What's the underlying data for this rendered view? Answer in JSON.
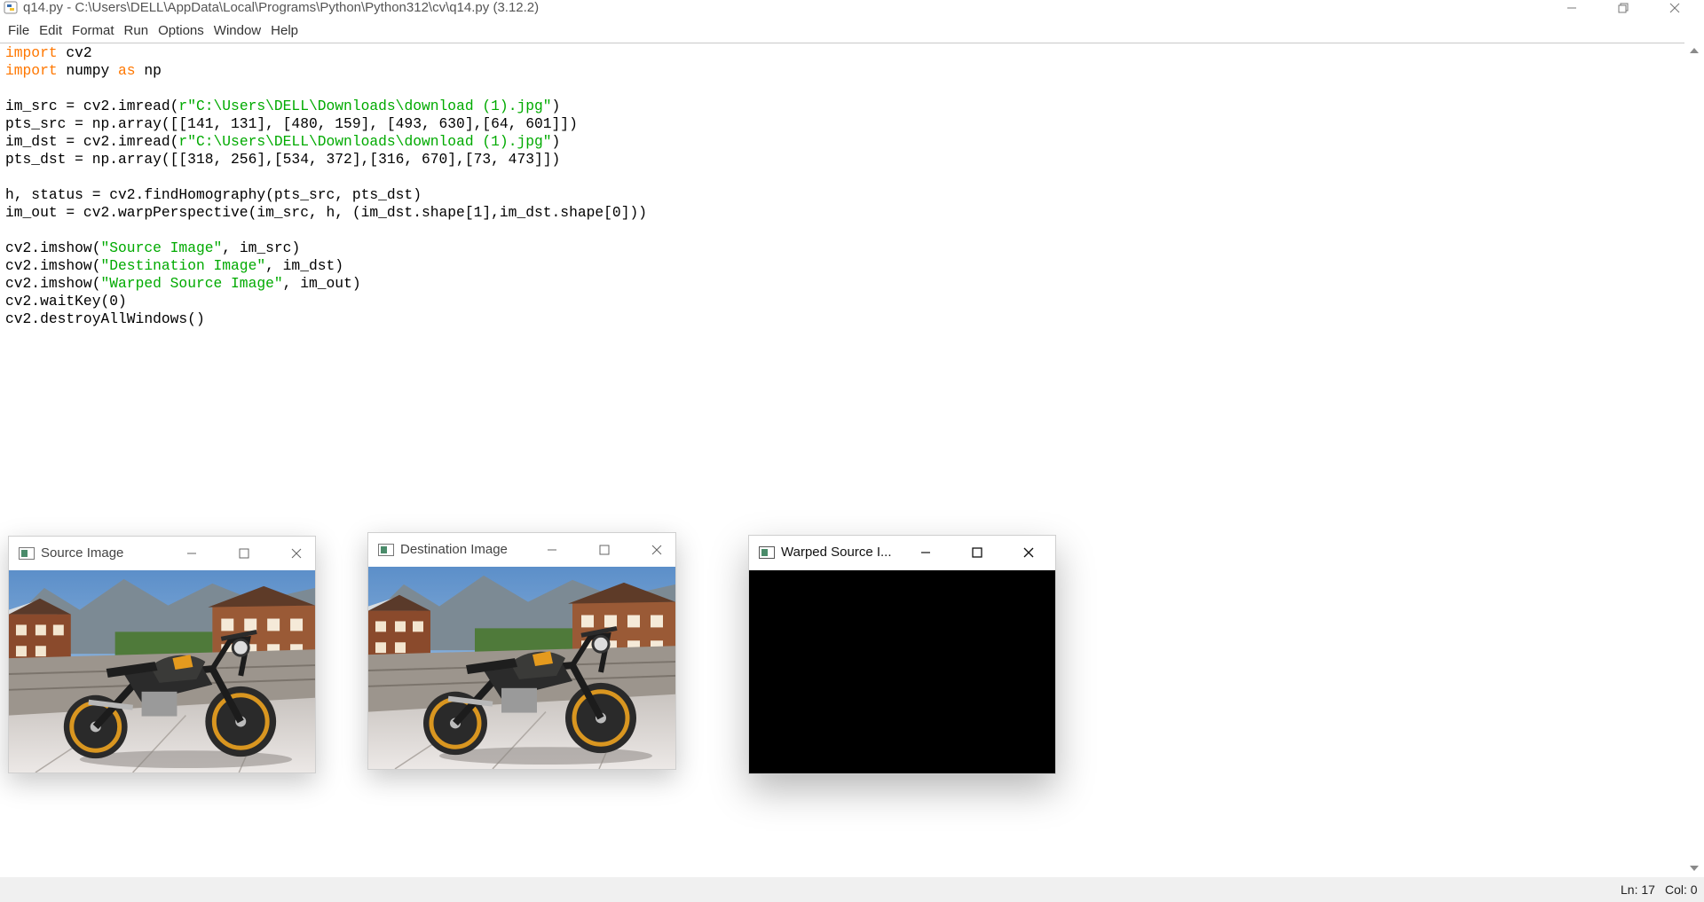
{
  "window": {
    "title": "q14.py - C:\\Users\\DELL\\AppData\\Local\\Programs\\Python\\Python312\\cv\\q14.py (3.12.2)",
    "controls": [
      "minimize-icon",
      "restore-icon",
      "close-icon"
    ]
  },
  "menu": {
    "items": [
      {
        "label": "File"
      },
      {
        "label": "Edit"
      },
      {
        "label": "Format"
      },
      {
        "label": "Run"
      },
      {
        "label": "Options"
      },
      {
        "label": "Window"
      },
      {
        "label": "Help"
      }
    ]
  },
  "editor": {
    "lines": [
      [
        {
          "t": "import",
          "c": "kw"
        },
        {
          "t": " cv2"
        }
      ],
      [
        {
          "t": "import",
          "c": "kw"
        },
        {
          "t": " numpy "
        },
        {
          "t": "as",
          "c": "kw"
        },
        {
          "t": " np"
        }
      ],
      [],
      [
        {
          "t": "im_src = cv2.imread("
        },
        {
          "t": "r\"C:\\Users\\DELL\\Downloads\\download (1).jpg\"",
          "c": "str"
        },
        {
          "t": ")"
        }
      ],
      [
        {
          "t": "pts_src = np.array([[141, 131], [480, 159], [493, 630],[64, 601]])"
        }
      ],
      [
        {
          "t": "im_dst = cv2.imread("
        },
        {
          "t": "r\"C:\\Users\\DELL\\Downloads\\download (1).jpg\"",
          "c": "str"
        },
        {
          "t": ")"
        }
      ],
      [
        {
          "t": "pts_dst = np.array([[318, 256],[534, 372],[316, 670],[73, 473]])"
        }
      ],
      [],
      [
        {
          "t": "h, status = cv2.findHomography(pts_src, pts_dst)"
        }
      ],
      [
        {
          "t": "im_out = cv2.warpPerspective(im_src, h, (im_dst.shape[1],im_dst.shape[0]))"
        }
      ],
      [],
      [
        {
          "t": "cv2.imshow("
        },
        {
          "t": "\"Source Image\"",
          "c": "str"
        },
        {
          "t": ", im_src)"
        }
      ],
      [
        {
          "t": "cv2.imshow("
        },
        {
          "t": "\"Destination Image\"",
          "c": "str"
        },
        {
          "t": ", im_dst)"
        }
      ],
      [
        {
          "t": "cv2.imshow("
        },
        {
          "t": "\"Warped Source Image\"",
          "c": "str"
        },
        {
          "t": ", im_out)"
        }
      ],
      [
        {
          "t": "cv2.waitKey(0)"
        }
      ],
      [
        {
          "t": "cv2.destroyAllWindows()"
        }
      ]
    ]
  },
  "status": {
    "line": "Ln: 17",
    "col": "Col: 0"
  },
  "cv_windows": {
    "source": {
      "title": "Source Image",
      "content": "photo"
    },
    "destination": {
      "title": "Destination Image",
      "content": "photo"
    },
    "warped": {
      "title": "Warped Source I...",
      "content": "black"
    }
  },
  "colors": {
    "keyword": "#ff7700",
    "string": "#00aa00",
    "warped_bg": "#000000"
  }
}
